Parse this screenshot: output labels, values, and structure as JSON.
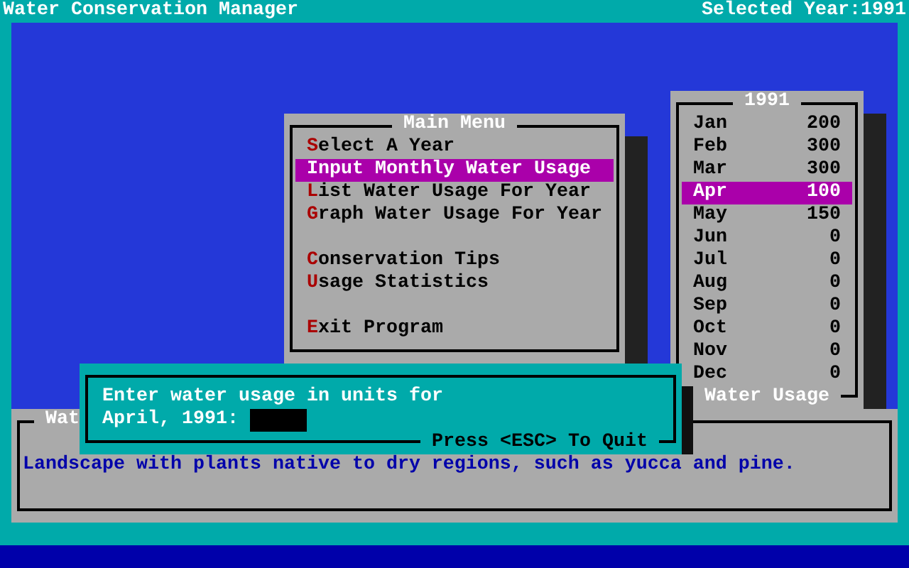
{
  "title_bar": {
    "title": "Water Conservation Manager",
    "selected_year": "Selected Year:1991"
  },
  "main_menu": {
    "title": "Main Menu",
    "groups": [
      [
        {
          "label": "Select A Year",
          "selected": false
        },
        {
          "label": "Input Monthly Water Usage",
          "selected": true
        },
        {
          "label": "List Water Usage For Year",
          "selected": false
        },
        {
          "label": "Graph Water Usage For Year",
          "selected": false
        }
      ],
      [
        {
          "label": "Conservation Tips",
          "selected": false
        },
        {
          "label": "Usage Statistics",
          "selected": false
        }
      ],
      [
        {
          "label": "Exit Program",
          "selected": false
        }
      ]
    ]
  },
  "year_window": {
    "title": "1991",
    "footer": "Water Usage",
    "months": [
      {
        "month": "Jan",
        "units": "200",
        "selected": false
      },
      {
        "month": "Feb",
        "units": "300",
        "selected": false
      },
      {
        "month": "Mar",
        "units": "300",
        "selected": false
      },
      {
        "month": "Apr",
        "units": "100",
        "selected": true
      },
      {
        "month": "May",
        "units": "150",
        "selected": false
      },
      {
        "month": "Jun",
        "units": "0",
        "selected": false
      },
      {
        "month": "Jul",
        "units": "0",
        "selected": false
      },
      {
        "month": "Aug",
        "units": "0",
        "selected": false
      },
      {
        "month": "Sep",
        "units": "0",
        "selected": false
      },
      {
        "month": "Oct",
        "units": "0",
        "selected": false
      },
      {
        "month": "Nov",
        "units": "0",
        "selected": false
      },
      {
        "month": "Dec",
        "units": "0",
        "selected": false
      }
    ]
  },
  "info_panel": {
    "title": "Wat",
    "text": "Landscape with plants native to dry regions, such as yucca and pine."
  },
  "dialog": {
    "prompt": "Enter water usage in units for",
    "field_label": "April, 1991:",
    "hint": "Press <ESC> To Quit"
  }
}
